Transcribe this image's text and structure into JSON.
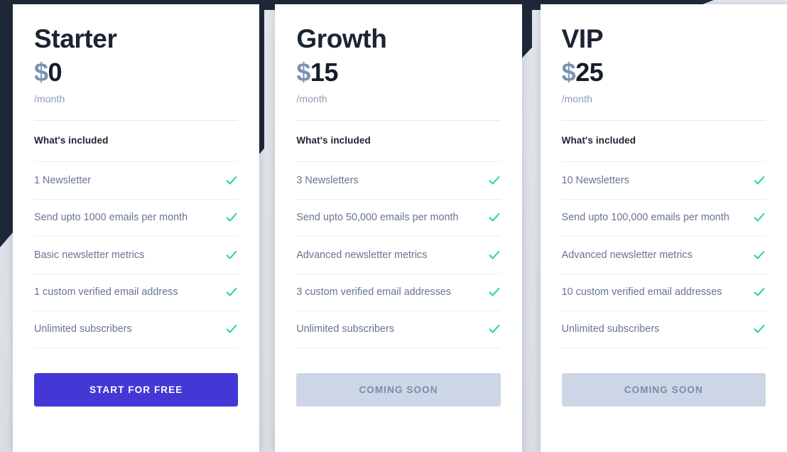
{
  "theme": {
    "navy": "#1e2838",
    "page_bg": "#e3e7ee",
    "card_bg": "#ffffff",
    "heading_color": "#1b2433",
    "currency_color": "#7d91b5",
    "muted_color": "#8b9ab5",
    "feature_color": "#66748f",
    "check_color": "#3ad39b",
    "primary_button_bg": "#4338d6",
    "primary_button_text": "#ffffff",
    "disabled_button_bg": "#ccd6e6",
    "disabled_button_text": "#7a8bab"
  },
  "labels": {
    "included_title": "What's included",
    "per_month": "/month",
    "currency_symbol": "$",
    "check_icon_name": "check-icon"
  },
  "plans": [
    {
      "name": "Starter",
      "currency": "$",
      "price": "0",
      "period": "/month",
      "included_title": "What's included",
      "features": [
        "1 Newsletter",
        "Send upto 1000 emails per month",
        "Basic newsletter metrics",
        "1 custom verified email address",
        "Unlimited subscribers"
      ],
      "cta_label": "START FOR FREE",
      "cta_state": "primary"
    },
    {
      "name": "Growth",
      "currency": "$",
      "price": "15",
      "period": "/month",
      "included_title": "What's included",
      "features": [
        "3 Newsletters",
        "Send upto 50,000 emails per month",
        "Advanced newsletter metrics",
        "3 custom verified email addresses",
        "Unlimited subscribers"
      ],
      "cta_label": "COMING SOON",
      "cta_state": "disabled"
    },
    {
      "name": "VIP",
      "currency": "$",
      "price": "25",
      "period": "/month",
      "included_title": "What's included",
      "features": [
        "10 Newsletters",
        "Send upto 100,000 emails per month",
        "Advanced newsletter metrics",
        "10 custom verified email addresses",
        "Unlimited subscribers"
      ],
      "cta_label": "COMING SOON",
      "cta_state": "disabled"
    }
  ]
}
